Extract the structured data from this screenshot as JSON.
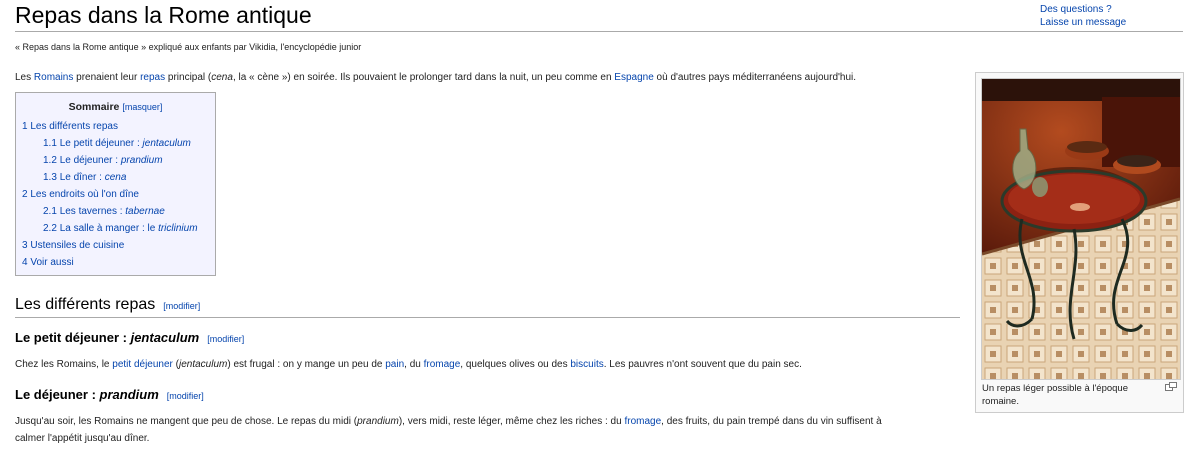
{
  "page": {
    "title": "Repas dans la Rome antique",
    "subtitle": "« Repas dans la Rome antique » expliqué aux enfants par Vikidia, l'encyclopédie junior"
  },
  "toplinks": {
    "questions": "Des questions ?",
    "message": "Laisse un message"
  },
  "intro": {
    "t1": "Les ",
    "l1": "Romains",
    "t2": " prenaient leur ",
    "l2": "repas",
    "t3": " principal (",
    "i1": "cena",
    "t4": ", la « cène ») en soirée. Ils pouvaient le prolonger tard dans la nuit, un peu comme en ",
    "l3": "Espagne",
    "t5": " où d'autres pays méditerranéens aujourd'hui."
  },
  "toc": {
    "title": "Sommaire",
    "toggle": "[masquer]",
    "items": [
      {
        "num": "1",
        "text": "Les différents repas",
        "em": ""
      },
      {
        "num": "1.1",
        "text": "Le petit déjeuner : ",
        "em": "jentaculum"
      },
      {
        "num": "1.2",
        "text": "Le déjeuner : ",
        "em": "prandium"
      },
      {
        "num": "1.3",
        "text": "Le dîner : ",
        "em": "cena"
      },
      {
        "num": "2",
        "text": "Les endroits où l'on dîne",
        "em": ""
      },
      {
        "num": "2.1",
        "text": "Les tavernes : ",
        "em": "tabernae"
      },
      {
        "num": "2.2",
        "text": "La salle à manger : le ",
        "em": "triclinium"
      },
      {
        "num": "3",
        "text": "Ustensiles de cuisine",
        "em": ""
      },
      {
        "num": "4",
        "text": "Voir aussi",
        "em": ""
      }
    ]
  },
  "sections": {
    "edit_label": "[modifier]",
    "h2": "Les différents repas",
    "h3a": {
      "text": "Le petit déjeuner : ",
      "em": "jentaculum"
    },
    "p1": {
      "t1": "Chez les Romains, le ",
      "l1": "petit déjeuner",
      "t2": " (",
      "i1": "jentaculum",
      "t3": ") est frugal : on y mange un peu de ",
      "l2": "pain",
      "t4": ", du ",
      "l3": "fromage",
      "t5": ", quelques olives ou des ",
      "l4": "biscuits",
      "t6": ". Les pauvres n'ont souvent que du pain sec."
    },
    "h3b": {
      "text": "Le déjeuner : ",
      "em": "prandium"
    },
    "p2": {
      "t1": "Jusqu'au soir, les Romains ne mangent que peu de chose. Le repas du midi (",
      "i1": "prandium",
      "t2": "), vers midi, reste léger, même chez les riches : du ",
      "l1": "fromage",
      "t3": ", des fruits, du pain trempé dans du vin suffisent à",
      "t4": "calmer l'appétit jusqu'au dîner."
    }
  },
  "thumb": {
    "caption": "Un repas léger possible à l'époque romaine."
  },
  "colors": {
    "link": "#0645ad",
    "toc_bg": "#f3f3ff",
    "rule": "#aaaaaa"
  }
}
